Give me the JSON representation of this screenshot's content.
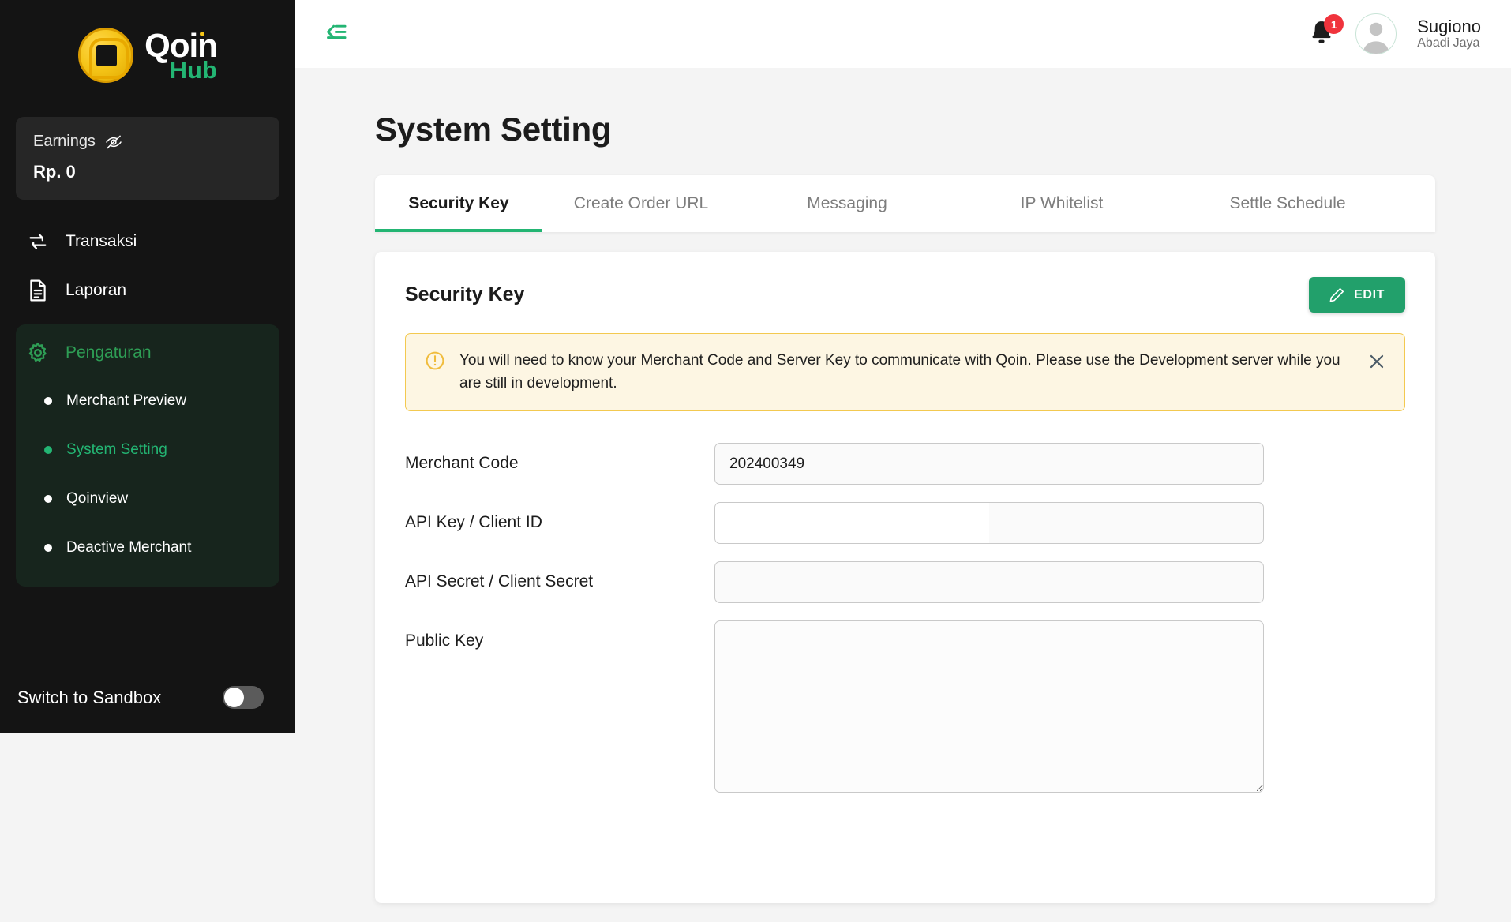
{
  "brand": {
    "name_primary": "Qoin",
    "name_secondary": "Hub",
    "coin_icon": "qoin-coin-icon"
  },
  "sidebar": {
    "earnings": {
      "label": "Earnings",
      "value": "Rp. 0",
      "visibility_icon": "eye-off-icon"
    },
    "items": [
      {
        "label": "Transaksi",
        "icon": "transfer-icon"
      },
      {
        "label": "Laporan",
        "icon": "document-icon"
      }
    ],
    "group": {
      "label": "Pengaturan",
      "icon": "gear-icon",
      "children": [
        {
          "label": "Merchant Preview",
          "active": false
        },
        {
          "label": "System Setting",
          "active": true
        },
        {
          "label": "Qoinview",
          "active": false
        },
        {
          "label": "Deactive Merchant",
          "active": false
        }
      ]
    },
    "sandbox": {
      "label": "Switch to Sandbox",
      "enabled": false
    }
  },
  "topbar": {
    "collapse_icon": "collapse-sidebar-icon",
    "bell_icon": "bell-icon",
    "notification_count": "1",
    "avatar_icon": "user-avatar-icon",
    "user_name": "Sugiono",
    "user_org": "Abadi Jaya"
  },
  "main": {
    "page_title": "System Setting",
    "tabs": [
      {
        "label": "Security Key",
        "active": true
      },
      {
        "label": "Create Order URL",
        "active": false
      },
      {
        "label": "Messaging",
        "active": false
      },
      {
        "label": "IP Whitelist",
        "active": false
      },
      {
        "label": "Settle Schedule",
        "active": false
      }
    ],
    "panel": {
      "title": "Security Key",
      "edit_label": "EDIT",
      "edit_icon": "pencil-icon",
      "alert": {
        "icon": "warning-circle-icon",
        "text": "You will need to know your Merchant Code and Server Key to communicate with Qoin. Please use the Development server while you are still in development.",
        "close_icon": "close-icon"
      },
      "fields": [
        {
          "label": "Merchant Code",
          "value": "202400349",
          "placeholder": "",
          "type": "input"
        },
        {
          "label": "API Key / Client ID",
          "value": "",
          "placeholder": "",
          "type": "input-autofill"
        },
        {
          "label": "API Secret / Client Secret",
          "value": "",
          "placeholder": "",
          "type": "input"
        },
        {
          "label": "Public Key",
          "value": "",
          "placeholder": "",
          "type": "textarea"
        }
      ]
    }
  },
  "colors": {
    "accent_green": "#23b573",
    "button_green": "#22a06b",
    "sidebar_bg": "#141414",
    "group_bg": "#17251d",
    "alert_bg": "#fdf6e3",
    "alert_border": "#f3c950",
    "badge_red": "#f0333c",
    "coin_gold": "#f5c518"
  }
}
